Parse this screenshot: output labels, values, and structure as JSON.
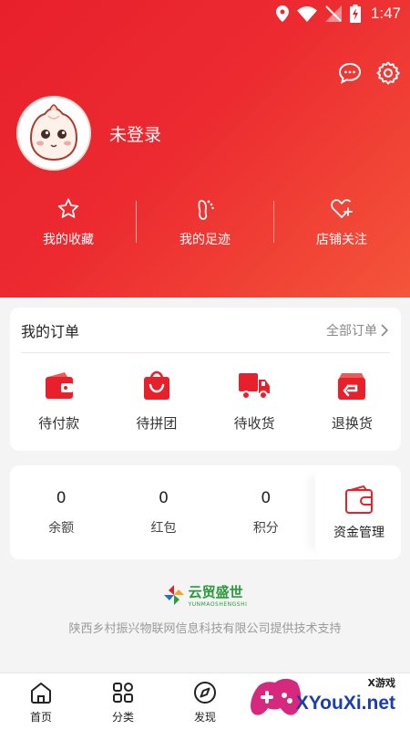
{
  "status_bar": {
    "time": "1:47"
  },
  "profile": {
    "login_text": "未登录"
  },
  "quick_links": [
    {
      "label": "我的收藏",
      "icon": "star-icon"
    },
    {
      "label": "我的足迹",
      "icon": "footprint-icon"
    },
    {
      "label": "店铺关注",
      "icon": "heart-plus-icon"
    }
  ],
  "orders": {
    "title": "我的订单",
    "all_label": "全部订单",
    "items": [
      {
        "label": "待付款",
        "icon": "wallet-icon"
      },
      {
        "label": "待拼团",
        "icon": "shopping-bag-icon"
      },
      {
        "label": "待收货",
        "icon": "truck-icon"
      },
      {
        "label": "退换货",
        "icon": "return-icon"
      }
    ]
  },
  "wallet": {
    "items": [
      {
        "value": "0",
        "label": "余额"
      },
      {
        "value": "0",
        "label": "红包"
      },
      {
        "value": "0",
        "label": "积分"
      }
    ],
    "manage_label": "资金管理"
  },
  "brand": {
    "logo_name": "云贸盛世",
    "logo_sub": "YUNMAOSHENGSHI",
    "support_text": "陕西乡村振兴物联网信息科技有限公司提供技术支持"
  },
  "tabbar": [
    {
      "label": "首页",
      "icon": "home-icon"
    },
    {
      "label": "分类",
      "icon": "grid-icon"
    },
    {
      "label": "发现",
      "icon": "compass-icon"
    }
  ],
  "watermark": {
    "small": "X游戏",
    "big": "XYouXi.net"
  },
  "colors": {
    "primary": "#e8202c",
    "gradient_end": "#f4553a",
    "brand_green": "#2a9a3b"
  }
}
